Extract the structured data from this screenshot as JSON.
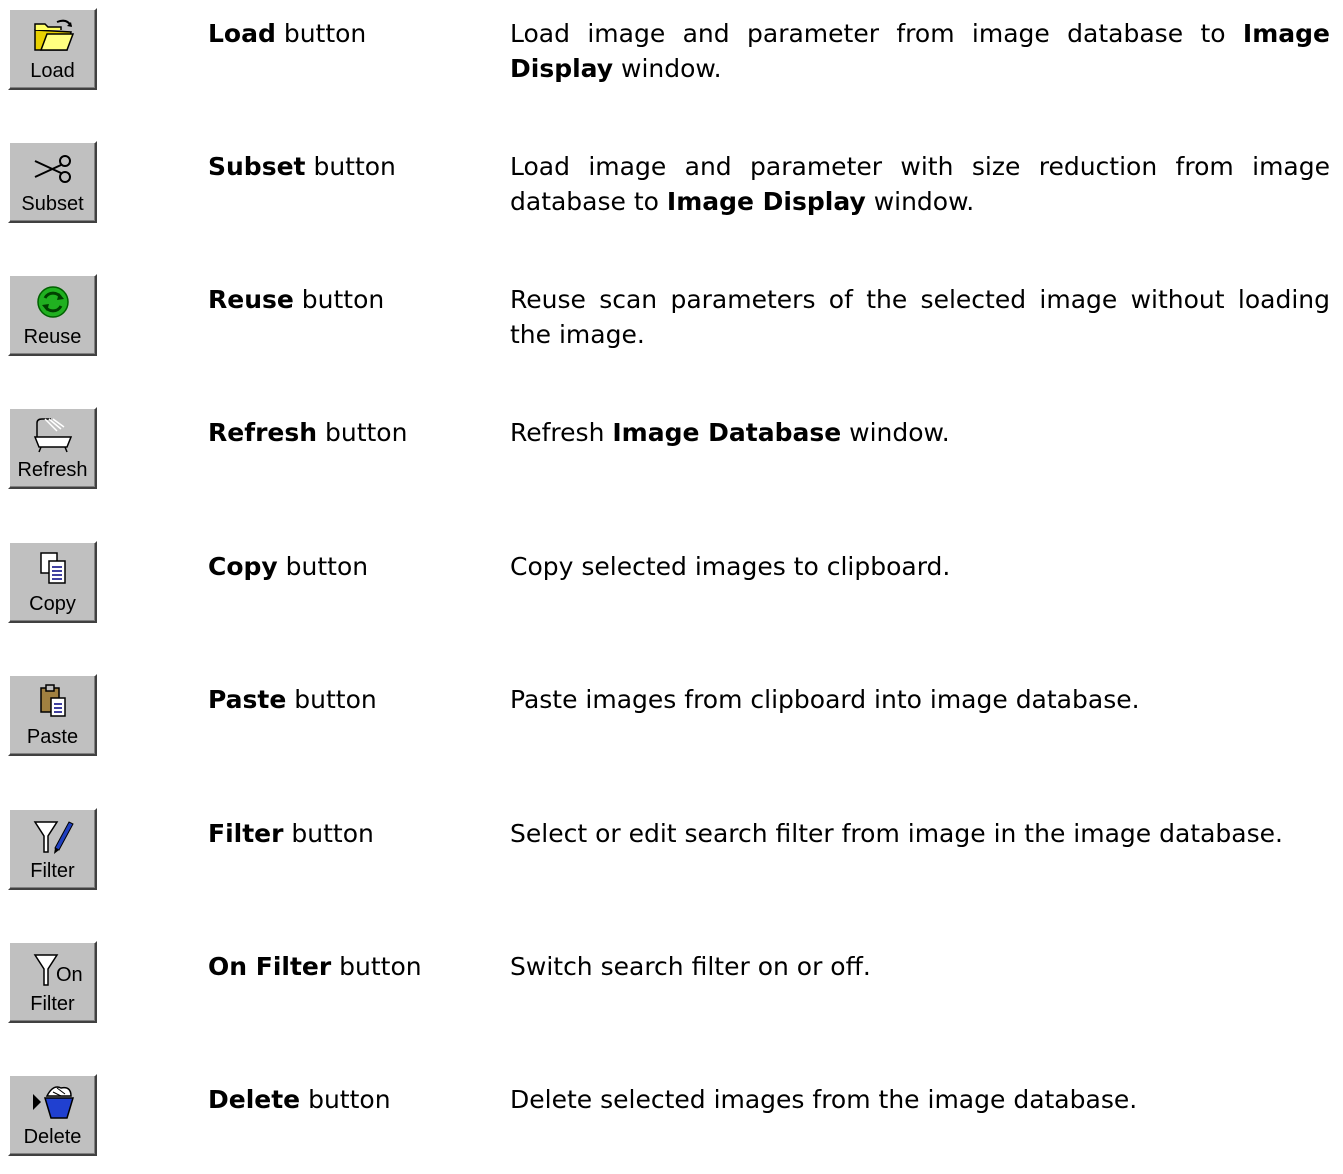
{
  "buttons": [
    {
      "icon": "open-folder-icon",
      "caption": "Load",
      "name": "Load",
      "suffix": " button",
      "desc": [
        {
          "t": "Load image and parameter from image database to "
        },
        {
          "b": "Image Display"
        },
        {
          "t": " window."
        }
      ]
    },
    {
      "icon": "scissors-icon",
      "caption": "Subset",
      "name": "Subset",
      "suffix": " button",
      "desc": [
        {
          "t": "Load image and parameter with size reduction from image database to "
        },
        {
          "b": "Image Display"
        },
        {
          "t": " window."
        }
      ]
    },
    {
      "icon": "recycle-arrows-icon",
      "caption": "Reuse",
      "name": "Reuse",
      "suffix": " button",
      "desc": [
        {
          "t": "Reuse scan parameters of the selected image without loading the image."
        }
      ]
    },
    {
      "icon": "bathtub-icon",
      "caption": "Refresh",
      "name": "Refresh",
      "suffix": " button",
      "desc": [
        {
          "t": "Refresh "
        },
        {
          "b": "Image Database"
        },
        {
          "t": " window."
        }
      ]
    },
    {
      "icon": "copy-documents-icon",
      "caption": "Copy",
      "name": "Copy",
      "suffix": " button",
      "desc": [
        {
          "t": "Copy selected images to clipboard."
        }
      ]
    },
    {
      "icon": "paste-clipboard-icon",
      "caption": "Paste",
      "name": "Paste",
      "suffix": " button",
      "desc": [
        {
          "t": "Paste images from clipboard into image database."
        }
      ]
    },
    {
      "icon": "funnel-pencil-icon",
      "caption": "Filter",
      "name": "Filter",
      "suffix": " button",
      "desc": [
        {
          "t": "Select or edit search filter from image in the image database."
        }
      ]
    },
    {
      "icon": "funnel-on-icon",
      "caption": "Filter",
      "caption_top": "On",
      "name": "On Filter",
      "suffix": " button",
      "desc": [
        {
          "t": "Switch search filter on or off."
        }
      ]
    },
    {
      "icon": "delete-bucket-icon",
      "caption": "Delete",
      "name": "Delete",
      "suffix": " button",
      "desc": [
        {
          "t": "Delete selected images from the image database."
        }
      ]
    }
  ]
}
